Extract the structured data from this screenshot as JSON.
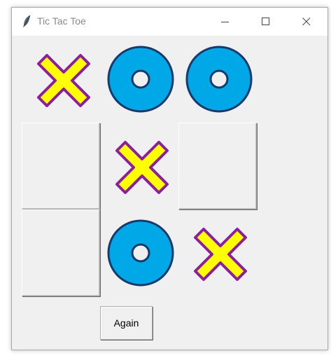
{
  "window": {
    "title": "Tic Tac Toe",
    "controls": [
      "minimize",
      "maximize",
      "close"
    ]
  },
  "board": {
    "cells": [
      [
        "X",
        "O",
        "O"
      ],
      [
        "",
        "X",
        ""
      ],
      [
        "",
        "O",
        "X"
      ]
    ]
  },
  "again_label": "Again",
  "colors": {
    "x_fill": "#ffff00",
    "x_outline": "#8b1fa0",
    "o_fill": "#00a8e8",
    "o_outline": "#163a6a"
  }
}
